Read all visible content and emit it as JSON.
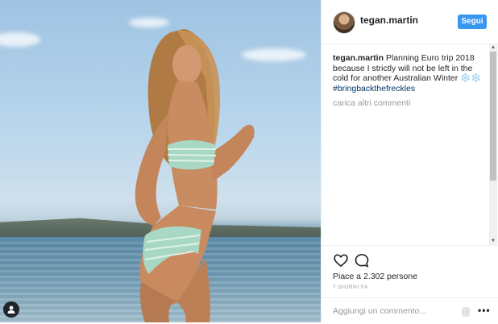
{
  "post": {
    "author": "tegan.martin",
    "follow_label": "Segui",
    "caption_user": "tegan.martin",
    "caption_text": "Planning Euro trip 2018 because I strictly will not be left in the cold for another Australian Winter ❄️❄️",
    "hashtag": "#bringbackthefreckles",
    "load_more_label": "carica altri commenti",
    "likes_text": "Piace a 2.302 persone",
    "timestamp": "7 GIORNI FA",
    "comment_placeholder": "Aggiungi un commento...",
    "more_label": "•••"
  },
  "icons": {
    "like": "heart-icon",
    "comment": "comment-icon",
    "user_tag": "user-tag-icon",
    "more": "more-options-icon"
  },
  "colors": {
    "accent": "#3897f0",
    "hashtag": "#003569",
    "muted": "#999999"
  }
}
